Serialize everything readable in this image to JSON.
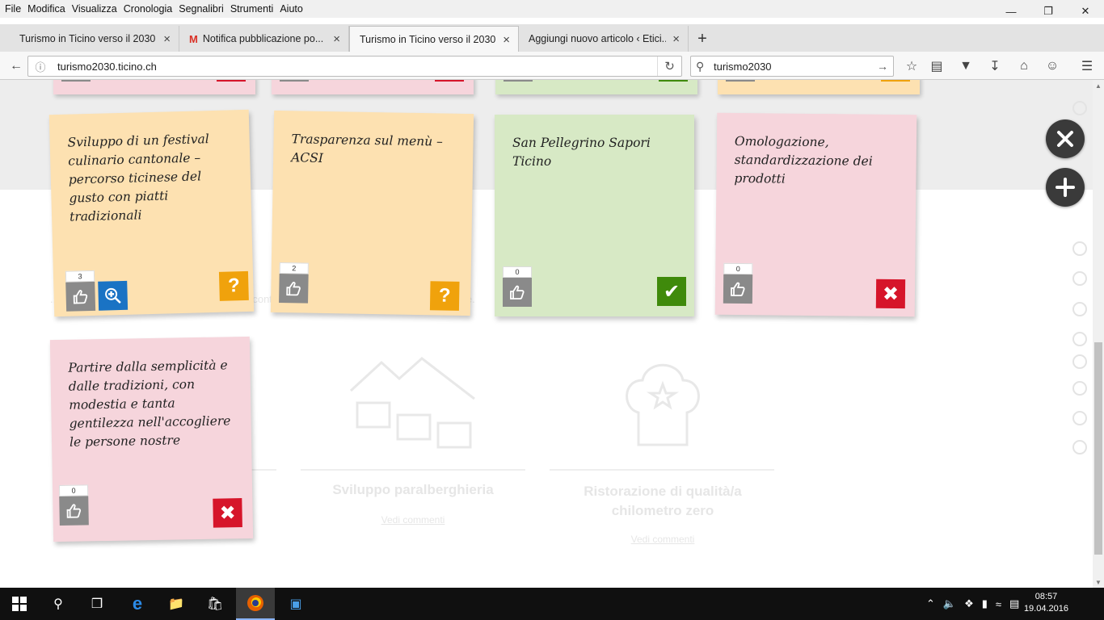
{
  "menu": [
    "File",
    "Modifica",
    "Visualizza",
    "Cronologia",
    "Segnalibri",
    "Strumenti",
    "Aiuto"
  ],
  "tabs": [
    {
      "title": "Turismo in Ticino verso il 2030",
      "icon": ""
    },
    {
      "title": "Notifica pubblicazione po...",
      "icon": "gmail-icon"
    },
    {
      "title": "Turismo in Ticino verso il 2030",
      "icon": ""
    },
    {
      "title": "Aggiungi nuovo articolo ‹ Etici...",
      "icon": ""
    }
  ],
  "active_tab": 2,
  "address": {
    "url": "turismo2030.ticino.ch"
  },
  "search": {
    "query": "turismo2030"
  },
  "notes": [
    {
      "text": "Sviluppo di un festival culinario cantonale – percorso ticinese del gusto con piatti tradizionali",
      "likes": "3",
      "status": "?",
      "color": "#fde1b1",
      "zoom": true
    },
    {
      "text": "Trasparenza sul menù – ACSI",
      "likes": "2",
      "status": "?",
      "color": "#fde1b1",
      "zoom": false
    },
    {
      "text": "San Pellegrino Sapori Ticino",
      "likes": "0",
      "status": "✔",
      "color": "#d7e9c5",
      "zoom": false
    },
    {
      "text": "Omologazione, standardizzazione dei prodotti",
      "likes": "0",
      "status": "✖",
      "color": "#f6d5dc",
      "zoom": false
    },
    {
      "text": "Partire dalla semplicità e dalle tradizioni, con modestia e tanta gentilezza nell'accogliere le persone nostre",
      "likes": "0",
      "status": "✖",
      "color": "#f6d5dc",
      "zoom": false
    }
  ],
  "background": {
    "cards": [
      {
        "title": "Sviluppo paralberghieria",
        "link": "Vedi commenti"
      },
      {
        "title": "Ristorazione di qualità/a chilometro zero",
        "link": "Vedi commenti"
      }
    ],
    "paragraph": "... della ristorazione che nell'alloggio, e alla continua ... anche di nicchia, ... etico e speciale."
  },
  "taskbar": {
    "time": "08:57",
    "date": "19.04.2016"
  }
}
